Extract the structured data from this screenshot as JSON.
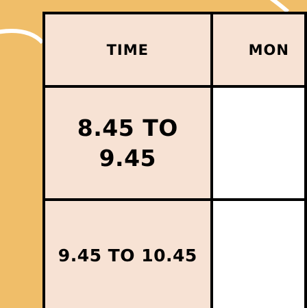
{
  "colors": {
    "background": "#f0be69",
    "cell_peach": "#f7e2d4",
    "cell_white": "#ffffff",
    "border": "#000000"
  },
  "table": {
    "headers": {
      "time": "TIME",
      "monday": "MON"
    },
    "rows": [
      {
        "time_line1": "8.45 TO",
        "time_line2": "9.45",
        "monday": ""
      },
      {
        "time": "9.45 TO 10.45",
        "monday": ""
      }
    ]
  }
}
